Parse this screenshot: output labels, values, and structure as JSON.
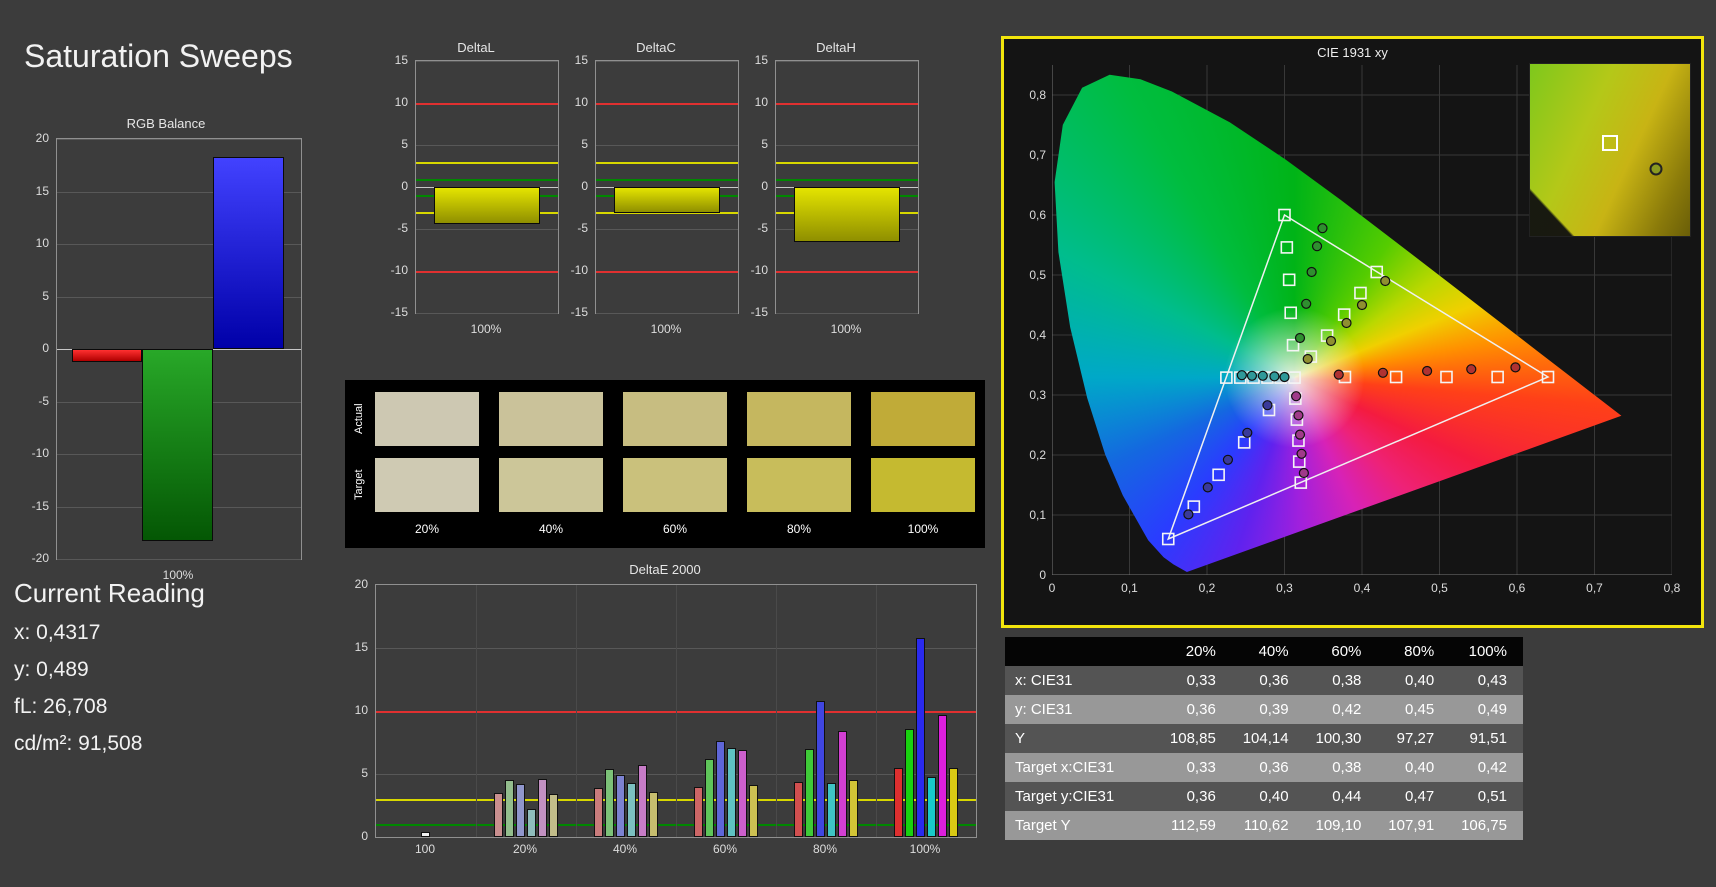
{
  "page": {
    "title": "Saturation Sweeps"
  },
  "current_reading": {
    "heading": "Current Reading",
    "x": "x: 0,4317",
    "y": "y: 0,489",
    "fl": "fL: 26,708",
    "cdm2": "cd/m²: 91,508"
  },
  "chart_data": {
    "rgb_balance": {
      "type": "bar",
      "title": "RGB Balance",
      "x_label": "100%",
      "ylim": [
        -20,
        20
      ],
      "ytick_step": 5,
      "bars": [
        {
          "name": "red",
          "value": -1.2,
          "color_top": "#ff3030",
          "color_bottom": "#b00000"
        },
        {
          "name": "green",
          "value": -18.3,
          "color_top": "#28a828",
          "color_bottom": "#045704"
        },
        {
          "name": "blue",
          "value": 18.3,
          "color_top": "#4242ff",
          "color_bottom": "#0000a8"
        }
      ]
    },
    "delta_charts": {
      "type": "bar",
      "ylim": [
        -15,
        15
      ],
      "ytick_step": 5,
      "ref_lines": [
        {
          "value": 10,
          "color": "#e03030"
        },
        {
          "value": -10,
          "color": "#e03030"
        },
        {
          "value": 3,
          "color": "#d8d800"
        },
        {
          "value": -3,
          "color": "#d8d800"
        },
        {
          "value": 1,
          "color": "#008800"
        },
        {
          "value": -1,
          "color": "#008800"
        }
      ],
      "charts": [
        {
          "title": "DeltaL",
          "x_label": "100%",
          "value": -4.4
        },
        {
          "title": "DeltaC",
          "x_label": "100%",
          "value": -3.1
        },
        {
          "title": "DeltaH",
          "x_label": "100%",
          "value": -6.6
        }
      ]
    },
    "deltae2000": {
      "type": "bar",
      "title": "DeltaE 2000",
      "ylim": [
        0,
        20
      ],
      "ytick_step": 5,
      "ref_lines": [
        {
          "value": 10,
          "color": "#e03030"
        },
        {
          "value": 3,
          "color": "#d8d800"
        },
        {
          "value": 1,
          "color": "#008800"
        }
      ],
      "groups": [
        {
          "label": "100",
          "bars": [
            {
              "color": "#f2f2f2",
              "value": 0.4
            }
          ]
        },
        {
          "label": "20%",
          "bars": [
            {
              "color": "#c98f8f",
              "value": 3.5
            },
            {
              "color": "#93bd8d",
              "value": 4.5
            },
            {
              "color": "#9096cc",
              "value": 4.2
            },
            {
              "color": "#8fbcbc",
              "value": 2.2
            },
            {
              "color": "#c291c2",
              "value": 4.6
            },
            {
              "color": "#c2bd8a",
              "value": 3.4
            }
          ]
        },
        {
          "label": "40%",
          "bars": [
            {
              "color": "#c97c7c",
              "value": 3.9
            },
            {
              "color": "#7cc178",
              "value": 5.4
            },
            {
              "color": "#7c82d1",
              "value": 4.9
            },
            {
              "color": "#7cc0c0",
              "value": 4.3
            },
            {
              "color": "#c77cc7",
              "value": 5.7
            },
            {
              "color": "#c6bd6e",
              "value": 3.6
            }
          ]
        },
        {
          "label": "60%",
          "bars": [
            {
              "color": "#cc6666",
              "value": 4.0
            },
            {
              "color": "#5fc55a",
              "value": 6.2
            },
            {
              "color": "#5f66d8",
              "value": 7.6
            },
            {
              "color": "#5fc2c2",
              "value": 7.1
            },
            {
              "color": "#cc5fcc",
              "value": 6.9
            },
            {
              "color": "#ccc052",
              "value": 4.1
            }
          ]
        },
        {
          "label": "80%",
          "bars": [
            {
              "color": "#d14f4f",
              "value": 4.4
            },
            {
              "color": "#3fca38",
              "value": 7.0
            },
            {
              "color": "#4046e0",
              "value": 10.8
            },
            {
              "color": "#3fc4c4",
              "value": 4.3
            },
            {
              "color": "#d23fd2",
              "value": 8.4
            },
            {
              "color": "#d2c436",
              "value": 4.5
            }
          ]
        },
        {
          "label": "100%",
          "bars": [
            {
              "color": "#dd2f2f",
              "value": 5.5
            },
            {
              "color": "#19d10f",
              "value": 8.6
            },
            {
              "color": "#2a2aee",
              "value": 15.8
            },
            {
              "color": "#19c9c9",
              "value": 4.8
            },
            {
              "color": "#dd1fdd",
              "value": 9.7
            },
            {
              "color": "#d9c914",
              "value": 5.5
            }
          ]
        }
      ]
    },
    "cie1931": {
      "type": "scatter",
      "title": "CIE 1931 xy",
      "xlim": [
        0,
        0.8
      ],
      "ylim": [
        0,
        0.85
      ],
      "x_tick_labels": [
        "0",
        "0,1",
        "0,2",
        "0,3",
        "0,4",
        "0,5",
        "0,6",
        "0,7",
        "0,8"
      ],
      "y_tick_labels": [
        "0",
        "0,1",
        "0,2",
        "0,3",
        "0,4",
        "0,5",
        "0,6",
        "0,7",
        "0,8"
      ],
      "gamut_triangle": [
        [
          0.64,
          0.33
        ],
        [
          0.3,
          0.6
        ],
        [
          0.15,
          0.06
        ]
      ],
      "target_series": [
        {
          "name": "white",
          "points": [
            [
              0.313,
              0.329
            ]
          ]
        },
        {
          "name": "red",
          "points": [
            [
              0.378,
              0.33
            ],
            [
              0.444,
              0.33
            ],
            [
              0.509,
              0.33
            ],
            [
              0.575,
              0.33
            ],
            [
              0.64,
              0.33
            ]
          ]
        },
        {
          "name": "green",
          "points": [
            [
              0.311,
              0.383
            ],
            [
              0.308,
              0.437
            ],
            [
              0.306,
              0.492
            ],
            [
              0.303,
              0.546
            ],
            [
              0.3,
              0.6
            ]
          ]
        },
        {
          "name": "blue",
          "points": [
            [
              0.28,
              0.275
            ],
            [
              0.248,
              0.221
            ],
            [
              0.215,
              0.167
            ],
            [
              0.183,
              0.114
            ],
            [
              0.15,
              0.06
            ]
          ]
        },
        {
          "name": "cyan",
          "points": [
            [
              0.295,
              0.329
            ],
            [
              0.278,
              0.329
            ],
            [
              0.26,
              0.329
            ],
            [
              0.243,
              0.329
            ],
            [
              0.225,
              0.329
            ]
          ]
        },
        {
          "name": "magenta",
          "points": [
            [
              0.314,
              0.294
            ],
            [
              0.316,
              0.259
            ],
            [
              0.318,
              0.224
            ],
            [
              0.319,
              0.189
            ],
            [
              0.321,
              0.154
            ]
          ]
        },
        {
          "name": "yellow",
          "points": [
            [
              0.334,
              0.364
            ],
            [
              0.355,
              0.399
            ],
            [
              0.377,
              0.434
            ],
            [
              0.398,
              0.47
            ],
            [
              0.419,
              0.505
            ]
          ]
        }
      ],
      "measured_series": [
        {
          "name": "red",
          "color": "#b03232",
          "points": [
            [
              0.37,
              0.334
            ],
            [
              0.427,
              0.337
            ],
            [
              0.484,
              0.34
            ],
            [
              0.541,
              0.343
            ],
            [
              0.598,
              0.346
            ]
          ]
        },
        {
          "name": "green",
          "color": "#2f8f2f",
          "points": [
            [
              0.32,
              0.395
            ],
            [
              0.328,
              0.452
            ],
            [
              0.335,
              0.505
            ],
            [
              0.342,
              0.548
            ],
            [
              0.349,
              0.578
            ]
          ]
        },
        {
          "name": "blue",
          "color": "#3a3a9a",
          "points": [
            [
              0.278,
              0.283
            ],
            [
              0.252,
              0.237
            ],
            [
              0.227,
              0.192
            ],
            [
              0.201,
              0.146
            ],
            [
              0.176,
              0.101
            ]
          ]
        },
        {
          "name": "cyan",
          "color": "#2f9999",
          "points": [
            [
              0.3,
              0.33
            ],
            [
              0.287,
              0.331
            ],
            [
              0.272,
              0.332
            ],
            [
              0.258,
              0.332
            ],
            [
              0.245,
              0.333
            ]
          ]
        },
        {
          "name": "magenta",
          "color": "#a03a8a",
          "points": [
            [
              0.315,
              0.298
            ],
            [
              0.318,
              0.266
            ],
            [
              0.32,
              0.234
            ],
            [
              0.322,
              0.202
            ],
            [
              0.325,
              0.17
            ]
          ]
        },
        {
          "name": "yellow",
          "color": "#8f8f30",
          "points": [
            [
              0.33,
              0.36
            ],
            [
              0.36,
              0.39
            ],
            [
              0.38,
              0.42
            ],
            [
              0.4,
              0.45
            ],
            [
              0.43,
              0.49
            ]
          ]
        }
      ],
      "inset": {
        "square_pos_pct": [
          50,
          46
        ],
        "dot_pos_pct": [
          79,
          61
        ]
      }
    }
  },
  "swatches": {
    "row_labels": [
      "Actual",
      "Target"
    ],
    "col_labels": [
      "20%",
      "40%",
      "60%",
      "80%",
      "100%"
    ],
    "actual": [
      "#cdc8b2",
      "#cac29a",
      "#c7bd81",
      "#c5b75f",
      "#c0ab38"
    ],
    "target": [
      "#cfcab3",
      "#ccc699",
      "#cac17c",
      "#c8bd5b",
      "#c5ba30"
    ]
  },
  "table": {
    "headers": [
      "",
      "20%",
      "40%",
      "60%",
      "80%",
      "100%"
    ],
    "rows": [
      {
        "label": "x: CIE31",
        "values": [
          "0,33",
          "0,36",
          "0,38",
          "0,40",
          "0,43"
        ]
      },
      {
        "label": "y: CIE31",
        "values": [
          "0,36",
          "0,39",
          "0,42",
          "0,45",
          "0,49"
        ]
      },
      {
        "label": "Y",
        "values": [
          "108,85",
          "104,14",
          "100,30",
          "97,27",
          "91,51"
        ]
      },
      {
        "label": "Target x:CIE31",
        "values": [
          "0,33",
          "0,36",
          "0,38",
          "0,40",
          "0,42"
        ]
      },
      {
        "label": "Target y:CIE31",
        "values": [
          "0,36",
          "0,40",
          "0,44",
          "0,47",
          "0,51"
        ]
      },
      {
        "label": "Target Y",
        "values": [
          "112,59",
          "110,62",
          "109,10",
          "107,91",
          "106,75"
        ]
      }
    ]
  }
}
